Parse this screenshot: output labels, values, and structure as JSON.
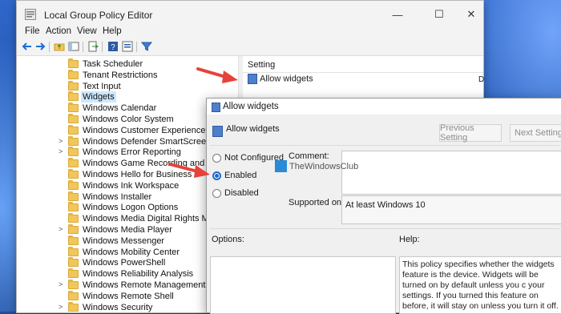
{
  "window": {
    "title": "Local Group Policy Editor",
    "minimize": "—",
    "maximize": "☐",
    "close": "✕"
  },
  "menu": [
    "File",
    "Action",
    "View",
    "Help"
  ],
  "toolbar_icons": [
    "back-icon",
    "forward-icon",
    "up-folder-icon",
    "show-hide-tree-icon",
    "export-icon",
    "help-icon",
    "properties-icon",
    "filter-icon"
  ],
  "tree": {
    "items": [
      {
        "label": "Task Scheduler",
        "expand": ""
      },
      {
        "label": "Tenant Restrictions",
        "expand": ""
      },
      {
        "label": "Text Input",
        "expand": ""
      },
      {
        "label": "Widgets",
        "expand": "",
        "selected": true
      },
      {
        "label": "Windows Calendar",
        "expand": ""
      },
      {
        "label": "Windows Color System",
        "expand": ""
      },
      {
        "label": "Windows Customer Experience Improv",
        "expand": ""
      },
      {
        "label": "Windows Defender SmartScreen",
        "expand": ">"
      },
      {
        "label": "Windows Error Reporting",
        "expand": ">"
      },
      {
        "label": "Windows Game Recording and Broadca",
        "expand": ""
      },
      {
        "label": "Windows Hello for Business",
        "expand": ""
      },
      {
        "label": "Windows Ink Workspace",
        "expand": ""
      },
      {
        "label": "Windows Installer",
        "expand": ""
      },
      {
        "label": "Windows Logon Options",
        "expand": ""
      },
      {
        "label": "Windows Media Digital Rights Manage",
        "expand": ""
      },
      {
        "label": "Windows Media Player",
        "expand": ">"
      },
      {
        "label": "Windows Messenger",
        "expand": ""
      },
      {
        "label": "Windows Mobility Center",
        "expand": ""
      },
      {
        "label": "Windows PowerShell",
        "expand": ""
      },
      {
        "label": "Windows Reliability Analysis",
        "expand": ""
      },
      {
        "label": "Windows Remote Management (WinRM",
        "expand": ">"
      },
      {
        "label": "Windows Remote Shell",
        "expand": ""
      },
      {
        "label": "Windows Security",
        "expand": ">"
      }
    ]
  },
  "list": {
    "header": "Setting",
    "rows": [
      {
        "label": "Allow widgets",
        "col": "D"
      }
    ]
  },
  "dialog": {
    "title": "Allow widgets",
    "heading": "Allow widgets",
    "prev_button": "Previous Setting",
    "next_button": "Next Setting",
    "options": [
      {
        "label": "Not Configured",
        "checked": false
      },
      {
        "label": "Enabled",
        "checked": true
      },
      {
        "label": "Disabled",
        "checked": false
      }
    ],
    "comment_label": "Comment:",
    "supported_label": "Supported on:",
    "supported_value": "At least Windows 10",
    "options_label": "Options:",
    "help_label": "Help:",
    "help_text": "This policy specifies whether the widgets feature is the device. Widgets will be turned on by default unless you c your settings. If you turned this feature on before, it will stay on unless you turn it off."
  },
  "watermark": "TheWindowsClub",
  "colors": {
    "arrow": "#e8413a",
    "selection": "#cce8ff",
    "radio_on": "#1b6ac9"
  }
}
